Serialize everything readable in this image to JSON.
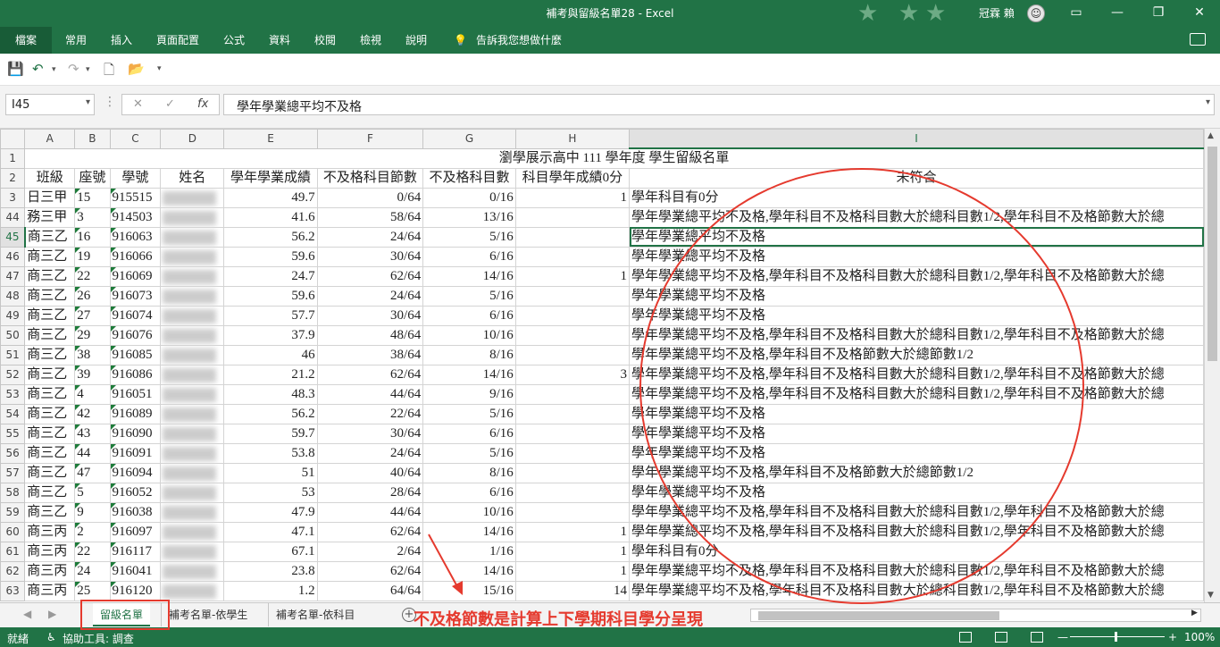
{
  "window": {
    "title": "補考與留級名單28  -  Excel",
    "user": "冠霖 賴",
    "minimize": "—",
    "restore": "❐",
    "close": "✕",
    "ribbon_display": "▭",
    "face": "☺"
  },
  "ribbon": {
    "file": "檔案",
    "tabs": [
      "常用",
      "插入",
      "頁面配置",
      "公式",
      "資料",
      "校閱",
      "檢視",
      "說明"
    ],
    "tellme": "告訴我您想做什麼"
  },
  "formula_bar": {
    "name_box": "I45",
    "fx": "fx",
    "cancel": "✕",
    "enter": "✓",
    "content": "學年學業總平均不及格"
  },
  "columns": [
    "A",
    "B",
    "C",
    "D",
    "E",
    "F",
    "G",
    "H",
    "I"
  ],
  "headers": {
    "title_row": "1",
    "header_row": "2",
    "title": "瀏學展示高中 111 學年度 學生留級名單",
    "cols": [
      "班級",
      "座號",
      "學號",
      "姓名",
      "學年學業成績",
      "不及格科目節數",
      "不及格科目數",
      "科目學年成績0分",
      "未符合"
    ]
  },
  "rows": [
    {
      "r": "3",
      "cls": "日三甲",
      "seat": "15",
      "id": "915515",
      "score": "49.7",
      "hrs": "0/64",
      "subj": "0/16",
      "zero": "1",
      "note": "學年科目有0分"
    },
    {
      "r": "44",
      "cls": "務三甲",
      "seat": "3",
      "id": "914503",
      "score": "41.6",
      "hrs": "58/64",
      "subj": "13/16",
      "zero": "",
      "note": "學年學業總平均不及格,學年科目不及格科目數大於總科目數1/2,學年科目不及格節數大於總"
    },
    {
      "r": "45",
      "cls": "商三乙",
      "seat": "16",
      "id": "916063",
      "score": "56.2",
      "hrs": "24/64",
      "subj": "5/16",
      "zero": "",
      "note": "學年學業總平均不及格"
    },
    {
      "r": "46",
      "cls": "商三乙",
      "seat": "19",
      "id": "916066",
      "score": "59.6",
      "hrs": "30/64",
      "subj": "6/16",
      "zero": "",
      "note": "學年學業總平均不及格"
    },
    {
      "r": "47",
      "cls": "商三乙",
      "seat": "22",
      "id": "916069",
      "score": "24.7",
      "hrs": "62/64",
      "subj": "14/16",
      "zero": "1",
      "note": "學年學業總平均不及格,學年科目不及格科目數大於總科目數1/2,學年科目不及格節數大於總"
    },
    {
      "r": "48",
      "cls": "商三乙",
      "seat": "26",
      "id": "916073",
      "score": "59.6",
      "hrs": "24/64",
      "subj": "5/16",
      "zero": "",
      "note": "學年學業總平均不及格"
    },
    {
      "r": "49",
      "cls": "商三乙",
      "seat": "27",
      "id": "916074",
      "score": "57.7",
      "hrs": "30/64",
      "subj": "6/16",
      "zero": "",
      "note": "學年學業總平均不及格"
    },
    {
      "r": "50",
      "cls": "商三乙",
      "seat": "29",
      "id": "916076",
      "score": "37.9",
      "hrs": "48/64",
      "subj": "10/16",
      "zero": "",
      "note": "學年學業總平均不及格,學年科目不及格科目數大於總科目數1/2,學年科目不及格節數大於總"
    },
    {
      "r": "51",
      "cls": "商三乙",
      "seat": "38",
      "id": "916085",
      "score": "46",
      "hrs": "38/64",
      "subj": "8/16",
      "zero": "",
      "note": "學年學業總平均不及格,學年科目不及格節數大於總節數1/2"
    },
    {
      "r": "52",
      "cls": "商三乙",
      "seat": "39",
      "id": "916086",
      "score": "21.2",
      "hrs": "62/64",
      "subj": "14/16",
      "zero": "3",
      "note": "學年學業總平均不及格,學年科目不及格科目數大於總科目數1/2,學年科目不及格節數大於總"
    },
    {
      "r": "53",
      "cls": "商三乙",
      "seat": "4",
      "id": "916051",
      "score": "48.3",
      "hrs": "44/64",
      "subj": "9/16",
      "zero": "",
      "note": "學年學業總平均不及格,學年科目不及格科目數大於總科目數1/2,學年科目不及格節數大於總"
    },
    {
      "r": "54",
      "cls": "商三乙",
      "seat": "42",
      "id": "916089",
      "score": "56.2",
      "hrs": "22/64",
      "subj": "5/16",
      "zero": "",
      "note": "學年學業總平均不及格"
    },
    {
      "r": "55",
      "cls": "商三乙",
      "seat": "43",
      "id": "916090",
      "score": "59.7",
      "hrs": "30/64",
      "subj": "6/16",
      "zero": "",
      "note": "學年學業總平均不及格"
    },
    {
      "r": "56",
      "cls": "商三乙",
      "seat": "44",
      "id": "916091",
      "score": "53.8",
      "hrs": "24/64",
      "subj": "5/16",
      "zero": "",
      "note": "學年學業總平均不及格"
    },
    {
      "r": "57",
      "cls": "商三乙",
      "seat": "47",
      "id": "916094",
      "score": "51",
      "hrs": "40/64",
      "subj": "8/16",
      "zero": "",
      "note": "學年學業總平均不及格,學年科目不及格節數大於總節數1/2"
    },
    {
      "r": "58",
      "cls": "商三乙",
      "seat": "5",
      "id": "916052",
      "score": "53",
      "hrs": "28/64",
      "subj": "6/16",
      "zero": "",
      "note": "學年學業總平均不及格"
    },
    {
      "r": "59",
      "cls": "商三乙",
      "seat": "9",
      "id": "916038",
      "score": "47.9",
      "hrs": "44/64",
      "subj": "10/16",
      "zero": "",
      "note": "學年學業總平均不及格,學年科目不及格科目數大於總科目數1/2,學年科目不及格節數大於總"
    },
    {
      "r": "60",
      "cls": "商三丙",
      "seat": "2",
      "id": "916097",
      "score": "47.1",
      "hrs": "62/64",
      "subj": "14/16",
      "zero": "1",
      "note": "學年學業總平均不及格,學年科目不及格科目數大於總科目數1/2,學年科目不及格節數大於總"
    },
    {
      "r": "61",
      "cls": "商三丙",
      "seat": "22",
      "id": "916117",
      "score": "67.1",
      "hrs": "2/64",
      "subj": "1/16",
      "zero": "1",
      "note": "學年科目有0分"
    },
    {
      "r": "62",
      "cls": "商三丙",
      "seat": "24",
      "id": "916041",
      "score": "23.8",
      "hrs": "62/64",
      "subj": "14/16",
      "zero": "1",
      "note": "學年學業總平均不及格,學年科目不及格科目數大於總科目數1/2,學年科目不及格節數大於總"
    },
    {
      "r": "63",
      "cls": "商三丙",
      "seat": "25",
      "id": "916120",
      "score": "1.2",
      "hrs": "64/64",
      "subj": "15/16",
      "zero": "14",
      "note": "學年學業總平均不及格,學年科目不及格科目數大於總科目數1/2,學年科目不及格節數大於總"
    }
  ],
  "sheet_tabs": [
    "留級名單",
    "補考名單-依學生",
    "補考名單-依科目"
  ],
  "add_sheet": "+",
  "annotation": "不及格節數是計算上下學期科目學分呈現",
  "status": {
    "ready": "就緒",
    "accessibility": "協助工具: 調查",
    "zoom_minus": "—",
    "zoom_plus": "+",
    "zoom": "100%"
  },
  "colors": {
    "excel_green": "#217346",
    "annotation_red": "#e53a2e"
  }
}
